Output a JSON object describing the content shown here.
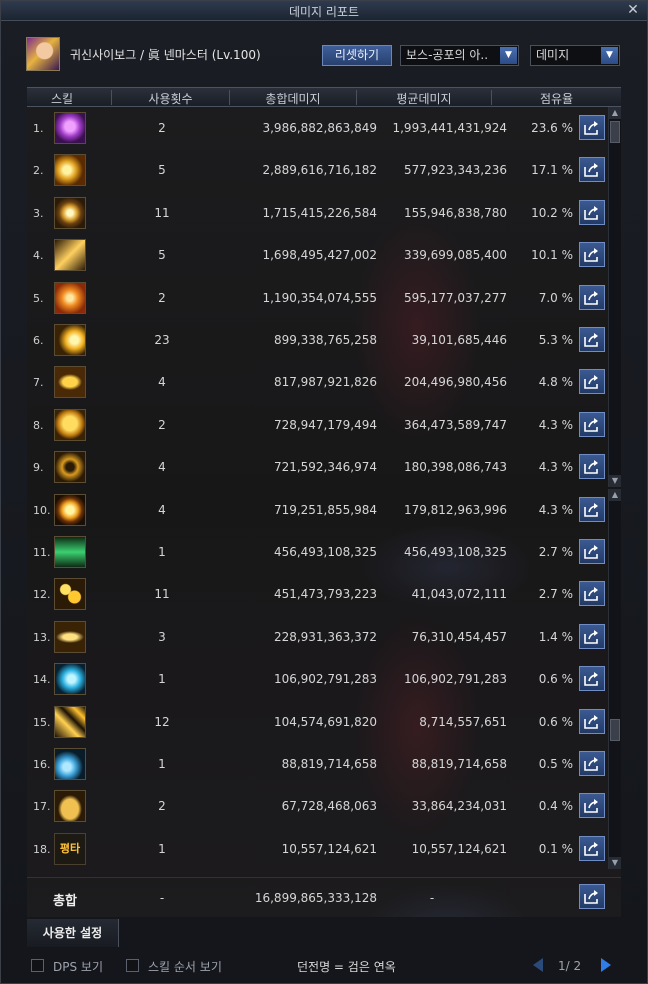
{
  "window": {
    "title": "데미지 리포트",
    "close_glyph": "✕"
  },
  "header": {
    "character": "귀신사이보그 / 眞 넨마스터 (Lv.100)",
    "reset_label": "리셋하기",
    "target_select": "보스-공포의 아..",
    "mode_select": "데미지"
  },
  "columns": {
    "skill": "스킬",
    "uses": "사용횟수",
    "total": "총합데미지",
    "avg": "평균데미지",
    "share": "점유율"
  },
  "rows": [
    {
      "rank": "1.",
      "icon": "purple-burst-icon",
      "uses": "2",
      "total": "3,986,882,863,849",
      "avg": "1,993,441,431,924",
      "share": "23.6 %"
    },
    {
      "rank": "2.",
      "icon": "golden-dragon-icon",
      "uses": "5",
      "total": "2,889,616,716,182",
      "avg": "577,923,343,236",
      "share": "17.1 %"
    },
    {
      "rank": "3.",
      "icon": "spiral-orb-icon",
      "uses": "11",
      "total": "1,715,415,226,584",
      "avg": "155,946,838,780",
      "share": "10.2 %"
    },
    {
      "rank": "4.",
      "icon": "lightning-arrow-icon",
      "uses": "5",
      "total": "1,698,495,427,002",
      "avg": "339,699,085,400",
      "share": "10.1 %"
    },
    {
      "rank": "5.",
      "icon": "aura-figure-icon",
      "uses": "2",
      "total": "1,190,354,074,555",
      "avg": "595,177,037,277",
      "share": "7.0 %"
    },
    {
      "rank": "6.",
      "icon": "fireball-icon",
      "uses": "23",
      "total": "899,338,765,258",
      "avg": "39,101,685,446",
      "share": "5.3 %"
    },
    {
      "rank": "7.",
      "icon": "dragon-head-icon",
      "uses": "4",
      "total": "817,987,921,826",
      "avg": "204,496,980,456",
      "share": "4.8 %"
    },
    {
      "rank": "8.",
      "icon": "lion-roar-icon",
      "uses": "2",
      "total": "728,947,179,494",
      "avg": "364,473,589,747",
      "share": "4.3 %"
    },
    {
      "rank": "9.",
      "icon": "vortex-ball-icon",
      "uses": "4",
      "total": "721,592,346,974",
      "avg": "180,398,086,743",
      "share": "4.3 %"
    },
    {
      "rank": "10.",
      "icon": "sun-ring-icon",
      "uses": "4",
      "total": "719,251,855,984",
      "avg": "179,812,963,996",
      "share": "4.3 %"
    },
    {
      "rank": "11.",
      "icon": "green-totem-icon",
      "uses": "1",
      "total": "456,493,108,325",
      "avg": "456,493,108,325",
      "share": "2.7 %"
    },
    {
      "rank": "12.",
      "icon": "energy-orbs-icon",
      "uses": "11",
      "total": "451,473,793,223",
      "avg": "41,043,072,111",
      "share": "2.7 %"
    },
    {
      "rank": "13.",
      "icon": "whirlwind-icon",
      "uses": "3",
      "total": "228,931,363,372",
      "avg": "76,310,454,457",
      "share": "1.4 %"
    },
    {
      "rank": "14.",
      "icon": "blue-strike-icon",
      "uses": "1",
      "total": "106,902,791,283",
      "avg": "106,902,791,283",
      "share": "0.6 %"
    },
    {
      "rank": "15.",
      "icon": "thunder-burst-icon",
      "uses": "12",
      "total": "104,574,691,820",
      "avg": "8,714,557,651",
      "share": "0.6 %"
    },
    {
      "rank": "16.",
      "icon": "blue-kick-icon",
      "uses": "1",
      "total": "88,819,714,658",
      "avg": "88,819,714,658",
      "share": "0.5 %"
    },
    {
      "rank": "17.",
      "icon": "golden-bell-icon",
      "uses": "2",
      "total": "67,728,468,063",
      "avg": "33,864,234,031",
      "share": "0.4 %"
    },
    {
      "rank": "18.",
      "icon_text": "평타",
      "uses": "1",
      "total": "10,557,124,621",
      "avg": "10,557,124,621",
      "share": "0.1 %"
    }
  ],
  "totals": {
    "label": "총합",
    "uses": "-",
    "total": "16,899,865,333,128",
    "avg": "-"
  },
  "settings_tab": "사용한 설정",
  "footer": {
    "dps_label": "DPS 보기",
    "skill_order_label": "스킬 순서 보기",
    "dungeon": "던전명 = 검은 연옥",
    "page": "1/ 2"
  },
  "colors": {
    "accent_blue": "#3b5a92",
    "gold": "#ffc33a"
  }
}
